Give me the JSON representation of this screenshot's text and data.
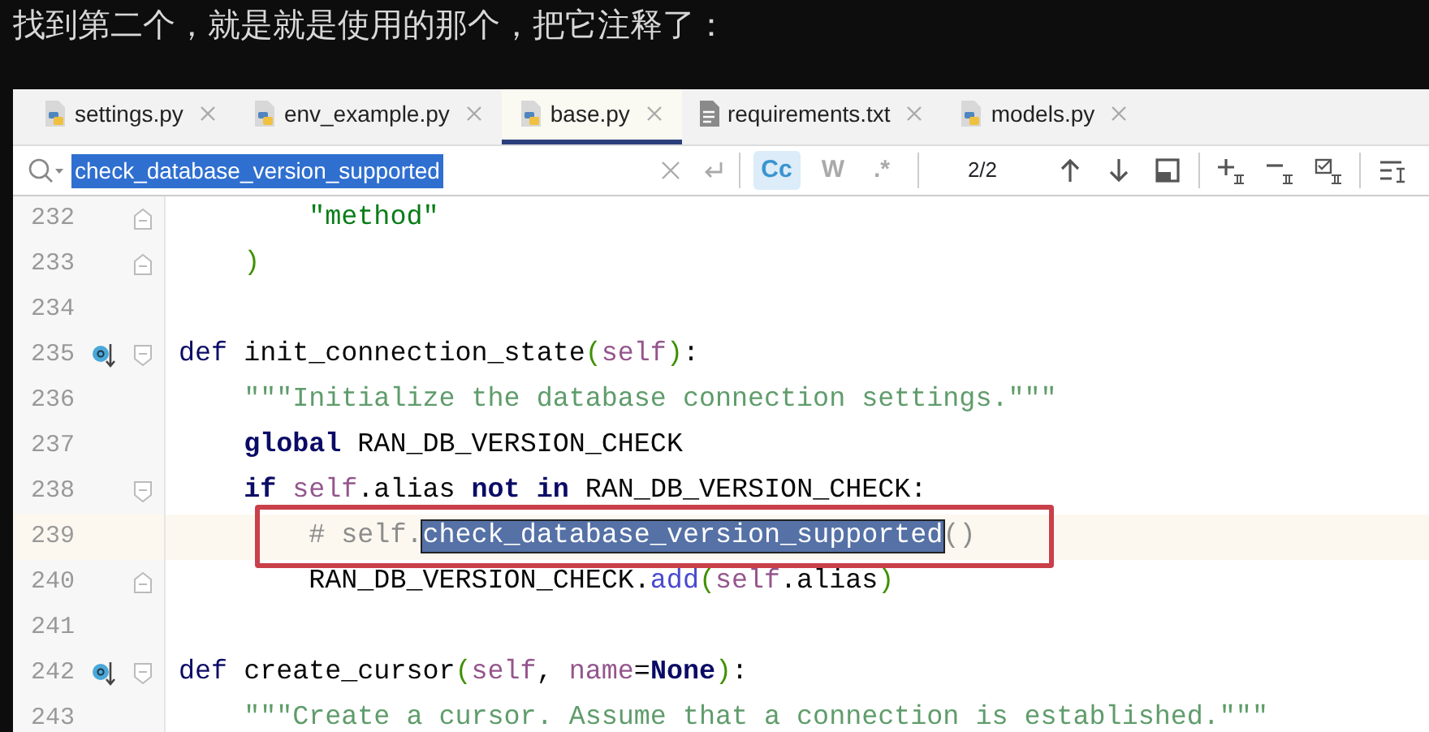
{
  "caption": "找到第二个，就是就是使用的那个，把它注释了：",
  "tabs": [
    {
      "label": "settings.py",
      "kind": "python",
      "selected": false
    },
    {
      "label": "env_example.py",
      "kind": "python",
      "selected": false
    },
    {
      "label": "base.py",
      "kind": "python",
      "selected": true
    },
    {
      "label": "requirements.txt",
      "kind": "text",
      "selected": false
    },
    {
      "label": "models.py",
      "kind": "python",
      "selected": false
    }
  ],
  "search": {
    "query": "check_database_version_supported",
    "options": [
      {
        "label": "Cc",
        "selected": true
      },
      {
        "label": "W",
        "selected": false
      },
      {
        "label": ".*",
        "selected": false
      }
    ],
    "match_count": "2/2"
  },
  "lines": [
    {
      "number": "232",
      "gutter": [
        {
          "kind": "fold_end"
        }
      ],
      "current": false,
      "boxed": false,
      "tokens": [
        {
          "t": "        \"method\"",
          "kind": "str"
        }
      ]
    },
    {
      "number": "233",
      "gutter": [
        {
          "kind": "fold_end"
        }
      ],
      "current": false,
      "boxed": false,
      "tokens": [
        {
          "t": "    )",
          "kind": "paren"
        }
      ]
    },
    {
      "number": "234",
      "current": false,
      "boxed": false
    },
    {
      "number": "235",
      "gutter": [
        {
          "kind": "override"
        },
        {
          "kind": "fold_start"
        }
      ],
      "current": false,
      "boxed": false,
      "tokens": [
        {
          "t": "def ",
          "kind": "def"
        },
        {
          "t": "init_connection_state",
          "kind": "plain"
        },
        {
          "t": "(",
          "kind": "paren"
        },
        {
          "t": "self",
          "kind": "self"
        },
        {
          "t": ")",
          "kind": "paren"
        },
        {
          "t": ":",
          "kind": "plain"
        }
      ]
    },
    {
      "number": "236",
      "current": false,
      "boxed": false,
      "tokens": [
        {
          "t": "    \"\"\"Initialize the database connection settings.\"\"\"",
          "kind": "doc"
        }
      ]
    },
    {
      "number": "237",
      "current": false,
      "boxed": false,
      "tokens": [
        {
          "t": "    global",
          "kind": "kw"
        },
        {
          "t": " RAN_DB_VERSION_CHECK",
          "kind": "plain"
        }
      ]
    },
    {
      "number": "238",
      "gutter": [
        {
          "kind": "fold_start"
        }
      ],
      "current": false,
      "boxed": false,
      "tokens": [
        {
          "t": "    if",
          "kind": "kw"
        },
        {
          "t": " self",
          "kind": "self"
        },
        {
          "t": ".alias ",
          "kind": "plain"
        },
        {
          "t": "not in",
          "kind": "kw"
        },
        {
          "t": " RAN_DB_VERSION_CHECK:",
          "kind": "plain"
        }
      ]
    },
    {
      "number": "239",
      "current": true,
      "boxed": true,
      "tokens": [
        {
          "t": "        # self.",
          "kind": "comment"
        },
        {
          "t": "check_database_version_supported",
          "kind": "match"
        },
        {
          "t": "()",
          "kind": "comment"
        }
      ]
    },
    {
      "number": "240",
      "gutter": [
        {
          "kind": "fold_end"
        }
      ],
      "current": false,
      "boxed": false,
      "tokens": [
        {
          "t": "        RAN_DB_VERSION_CHECK.",
          "kind": "plain"
        },
        {
          "t": "add",
          "kind": "call"
        },
        {
          "t": "(",
          "kind": "paren"
        },
        {
          "t": "self",
          "kind": "self"
        },
        {
          "t": ".alias",
          "kind": "plain"
        },
        {
          "t": ")",
          "kind": "paren"
        }
      ]
    },
    {
      "number": "241",
      "current": false,
      "boxed": false
    },
    {
      "number": "242",
      "gutter": [
        {
          "kind": "override"
        },
        {
          "kind": "fold_start"
        }
      ],
      "current": false,
      "boxed": false,
      "tokens": [
        {
          "t": "def ",
          "kind": "def"
        },
        {
          "t": "create_cursor",
          "kind": "plain"
        },
        {
          "t": "(",
          "kind": "paren"
        },
        {
          "t": "self",
          "kind": "self"
        },
        {
          "t": ", ",
          "kind": "plain"
        },
        {
          "t": "name",
          "kind": "self"
        },
        {
          "t": "=",
          "kind": "plain"
        },
        {
          "t": "None",
          "kind": "kw"
        },
        {
          "t": ")",
          "kind": "paren"
        },
        {
          "t": ":",
          "kind": "plain"
        }
      ]
    },
    {
      "number": "243",
      "current": false,
      "boxed": false,
      "tokens": [
        {
          "t": "    \"\"\"Create a cursor. Assume that a connection is established.\"\"\"",
          "kind": "doc"
        }
      ]
    }
  ]
}
